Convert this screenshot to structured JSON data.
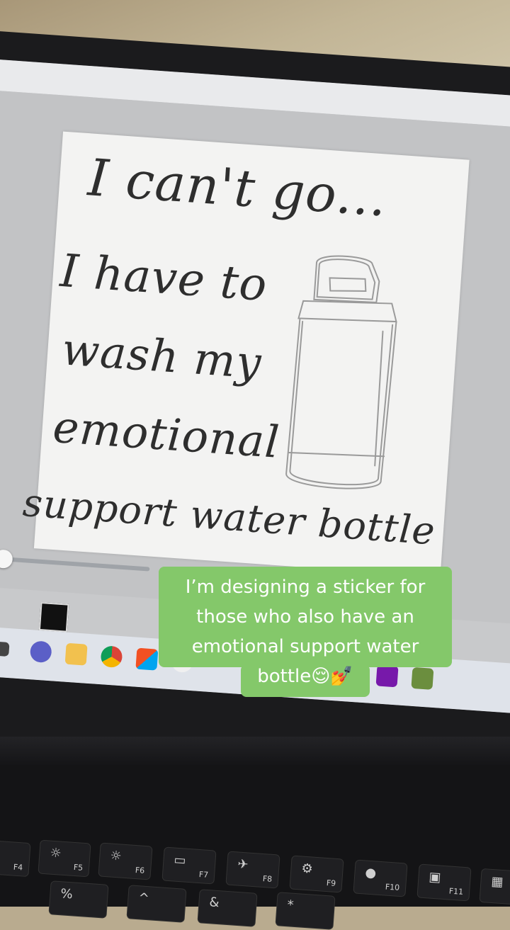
{
  "sticker": {
    "line1": "I can't go...",
    "line2": "I have to",
    "line3": "wash my",
    "line4": "emotional",
    "line5": "support water bottle"
  },
  "caption": {
    "line1": "I’m designing a sticker for",
    "line2": "those who also have an",
    "line3": "emotional support water",
    "line4": "bottle😌💅"
  },
  "taskbar_icons": [
    "search-icon",
    "task-view-icon",
    "teams-icon",
    "folder-icon",
    "chrome-icon",
    "store-icon",
    "itunes-icon",
    "powerpoint-icon",
    "onenote-icon",
    "minecraft-icon"
  ],
  "keys": {
    "f4": "F4",
    "f5": "F5",
    "f6": "F6",
    "f7": "F7",
    "f8": "F8",
    "f9": "F9",
    "f10": "F10",
    "f11": "F11",
    "percent": "%",
    "amp": "&",
    "star": "*"
  },
  "colors": {
    "caption_bg": "#84c86a",
    "slider_accent": "#2f6fd4",
    "paper": "#f3f3f2"
  }
}
